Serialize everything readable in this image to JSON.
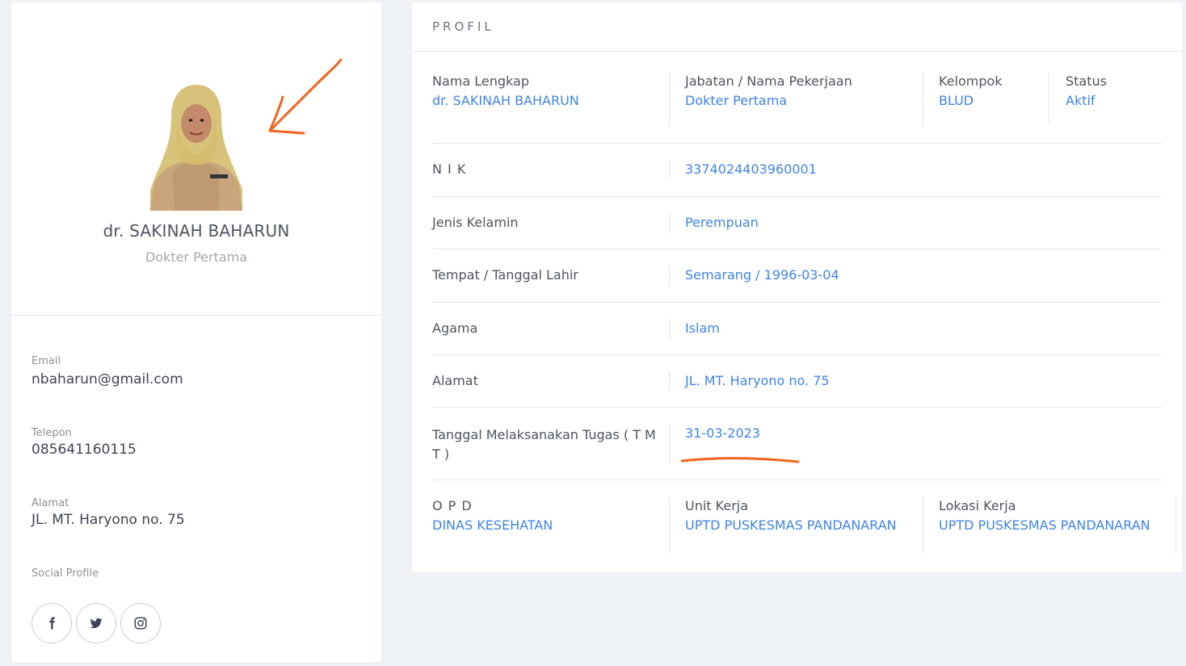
{
  "left_card": {
    "name": "dr. SAKINAH BAHARUN",
    "job_title": "Dokter Pertama",
    "email_label": "Email",
    "email_value": "nbaharun@gmail.com",
    "phone_label": "Telepon",
    "phone_value": "085641160115",
    "address_label": "Alamat",
    "address_value": "JL. MT. Haryono no. 75",
    "social_label": "Social Profile",
    "social_icons": [
      "facebook-icon",
      "twitter-icon",
      "instagram-icon"
    ]
  },
  "right_card": {
    "title": "PROFIL",
    "top_row": [
      {
        "label": "Nama Lengkap",
        "value": "dr. SAKINAH BAHARUN"
      },
      {
        "label": "Jabatan / Nama Pekerjaan",
        "value": "Dokter Pertama"
      },
      {
        "label": "Kelompok",
        "value": "BLUD"
      },
      {
        "label": "Status",
        "value": "Aktif"
      }
    ],
    "rows": [
      {
        "label": "N I K",
        "value": "3374024403960001"
      },
      {
        "label": "Jenis Kelamin",
        "value": "Perempuan"
      },
      {
        "label": "Tempat / Tanggal Lahir",
        "value": "Semarang / 1996-03-04"
      },
      {
        "label": "Agama",
        "value": "Islam"
      },
      {
        "label": "Alamat",
        "value": "JL. MT. Haryono no. 75"
      },
      {
        "label": "Tanggal Melaksanakan Tugas ( T M T )",
        "value": "31-03-2023"
      }
    ],
    "bottom_row": [
      {
        "label": "O P D",
        "value": "DINAS KESEHATAN"
      },
      {
        "label": "Unit Kerja",
        "value": "UPTD PUSKESMAS PANDANARAN"
      },
      {
        "label": "Lokasi Kerja",
        "value": "UPTD PUSKESMAS PANDANARAN"
      }
    ]
  },
  "colors": {
    "background": "#eef2f6",
    "card": "#ffffff",
    "link_blue": "#3f84e5",
    "annotation_orange": "#f0641e"
  }
}
